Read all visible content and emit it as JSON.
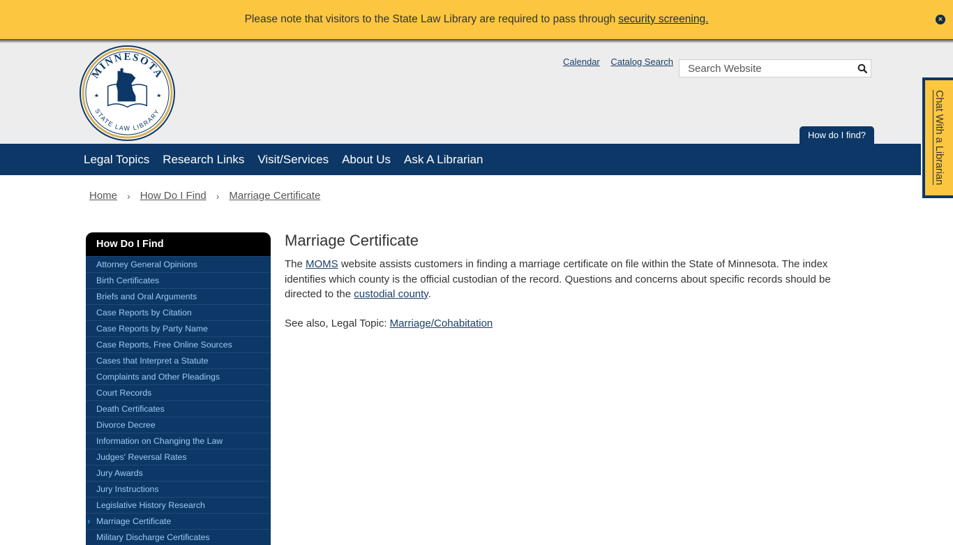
{
  "alert": {
    "text": "Please note that visitors to the State Law Library are required to pass through",
    "link": "security screening.",
    "close_icon": "close-circle-icon"
  },
  "header": {
    "logo_text_top": "MINNESOTA",
    "logo_text_bottom": "STATE LAW LIBRARY",
    "util_links": [
      "Calendar",
      "Catalog Search"
    ],
    "search": {
      "placeholder": "Search Website",
      "value": "",
      "icon": "search-icon"
    },
    "how_do_i_find": "How do I find?"
  },
  "nav": {
    "items": [
      "Legal Topics",
      "Research Links",
      "Visit/Services",
      "About Us",
      "Ask A Librarian"
    ]
  },
  "chat": {
    "label": "Chat With a Librarian"
  },
  "breadcrumb": [
    "Home",
    "How Do I Find",
    "Marriage Certificate"
  ],
  "sidebar": {
    "title": "How Do I Find",
    "items": [
      "Attorney General Opinions",
      "Birth Certificates",
      "Briefs and Oral Arguments",
      "Case Reports by Citation",
      "Case Reports by Party Name",
      "Case Reports, Free Online Sources",
      "Cases that Interpret a Statute",
      "Complaints and Other Pleadings",
      "Court Records",
      "Death Certificates",
      "Divorce Decree",
      "Information on Changing the Law",
      "Judges' Reversal Rates",
      "Jury Awards",
      "Jury Instructions",
      "Legislative History Research",
      "Marriage Certificate",
      "Military Discharge Certificates"
    ],
    "active_index": 16
  },
  "content": {
    "title": "Marriage Certificate",
    "p1_before": "The ",
    "p1_link1": "MOMS",
    "p1_middle": " website assists customers in finding a marriage certificate on file within the State of Minnesota. The index identifies which county is the official custodian of the record. Questions and concerns about specific records should be directed to the ",
    "p1_link2": "custodial county",
    "p1_after": ".",
    "p2_before": "See also, Legal Topic: ",
    "p2_link": "Marriage/Cohabitation"
  },
  "colors": {
    "banner": "#fdc641",
    "navy": "#0c3766",
    "sidebar_link": "#9ccbf5",
    "header_bg": "#ededed"
  }
}
